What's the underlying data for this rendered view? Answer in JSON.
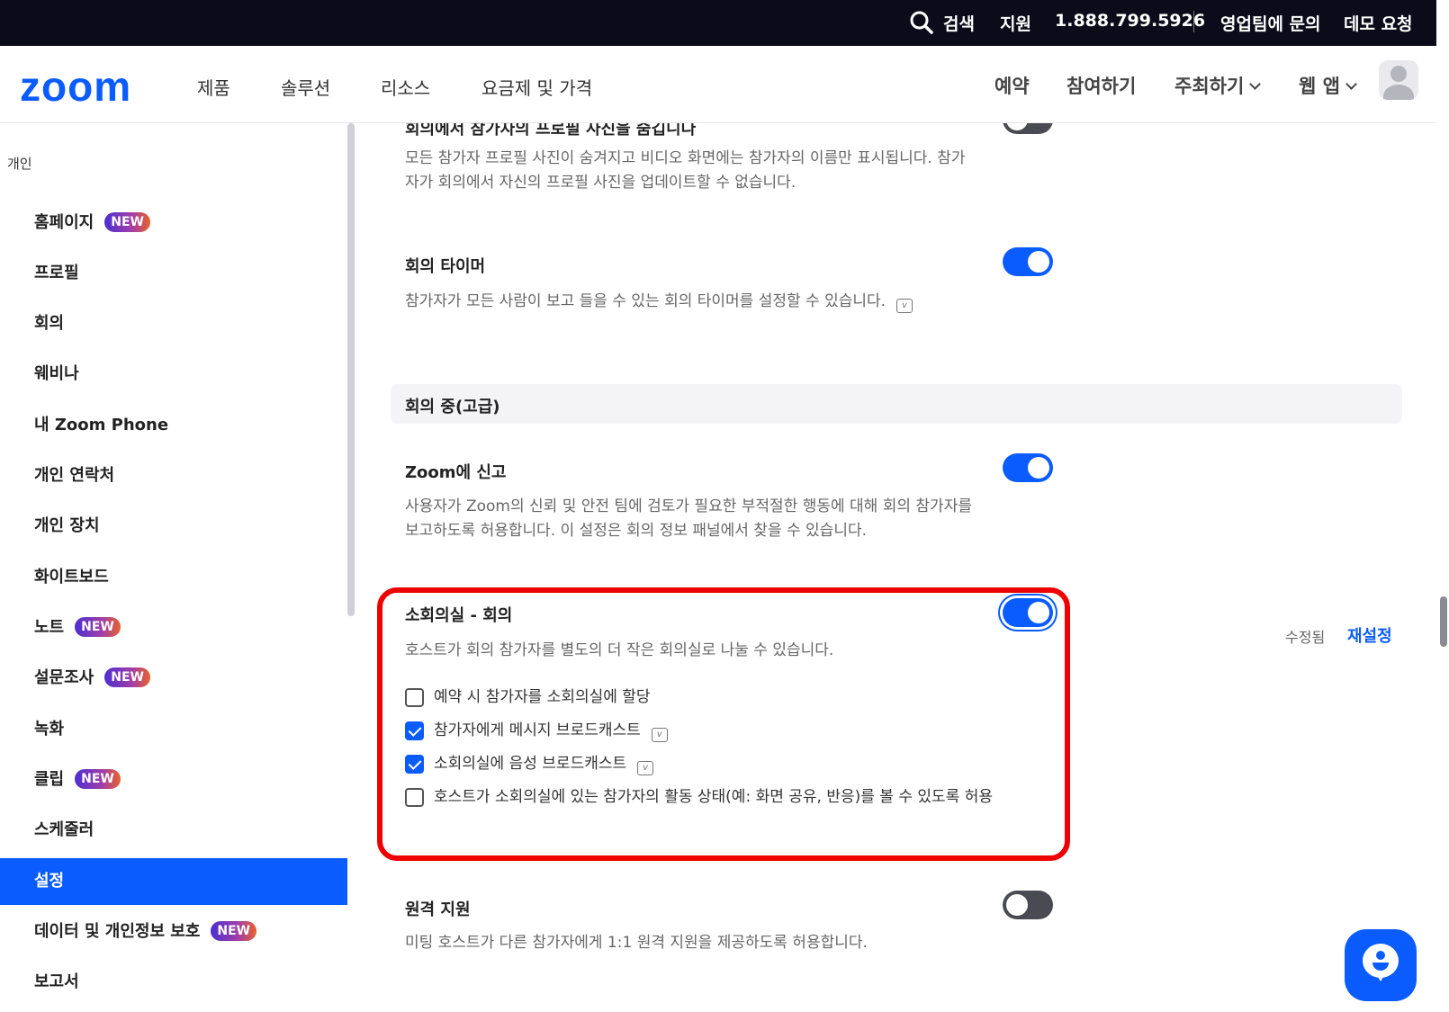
{
  "topbar": {
    "search": "검색",
    "support": "지원",
    "phone": "1.888.799.5926",
    "contact_sales": "영업팀에 문의",
    "demo": "데모 요청"
  },
  "header": {
    "logo": "zoom",
    "nav": [
      "제품",
      "솔루션",
      "리소스",
      "요금제 및 가격"
    ],
    "schedule": "예약",
    "join": "참여하기",
    "host": "주최하기",
    "web_app": "웹 앱"
  },
  "sidebar": {
    "heading": "개인",
    "badge_text": "NEW",
    "items": [
      {
        "label": "홈페이지",
        "new": true
      },
      {
        "label": "프로필",
        "new": false
      },
      {
        "label": "회의",
        "new": false
      },
      {
        "label": "웨비나",
        "new": false
      },
      {
        "label": "내 Zoom Phone",
        "new": false
      },
      {
        "label": "개인 연락처",
        "new": false
      },
      {
        "label": "개인 장치",
        "new": false
      },
      {
        "label": "화이트보드",
        "new": false
      },
      {
        "label": "노트",
        "new": true
      },
      {
        "label": "설문조사",
        "new": true
      },
      {
        "label": "녹화",
        "new": false
      },
      {
        "label": "클립",
        "new": true
      },
      {
        "label": "스케줄러",
        "new": false
      },
      {
        "label": "설정",
        "new": false,
        "active": true
      },
      {
        "label": "데이터 및 개인정보 보호",
        "new": true
      },
      {
        "label": "보고서",
        "new": false
      }
    ]
  },
  "settings": {
    "hide_photos": {
      "title": "회의에서 참가자의 프로필 사진을 숨깁니다",
      "desc": "모든 참가자 프로필 사진이 숨겨지고 비디오 화면에는 참가자의 이름만 표시됩니다. 참가자가 회의에서 자신의 프로필 사진을 업데이트할 수 없습니다.",
      "enabled": false
    },
    "meeting_timer": {
      "title": "회의 타이머",
      "desc": "참가자가 모든 사람이 보고 들을 수 있는 회의 타이머를 설정할 수 있습니다.",
      "enabled": true
    },
    "section_advanced": "회의 중(고급)",
    "report_to_zoom": {
      "title": "Zoom에 신고",
      "desc": "사용자가 Zoom의 신뢰 및 안전 팀에 검토가 필요한 부적절한 행동에 대해 회의 참가자를 보고하도록 허용합니다. 이 설정은 회의 정보 패널에서 찾을 수 있습니다.",
      "enabled": true
    },
    "breakout_rooms": {
      "title": "소회의실 - 회의",
      "desc": "호스트가 회의 참가자를 별도의 더 작은 회의실로 나눌 수 있습니다.",
      "enabled": true,
      "modified": "수정됨",
      "reset": "재설정",
      "options": [
        {
          "label": "예약 시 참가자를 소회의실에 할당",
          "checked": false
        },
        {
          "label": "참가자에게 메시지 브로드캐스트",
          "checked": true
        },
        {
          "label": "소회의실에 음성 브로드캐스트",
          "checked": true
        },
        {
          "label": "호스트가 소회의실에 있는 참가자의 활동 상태(예: 화면 공유, 반응)를 볼 수 있도록 허용",
          "checked": false
        }
      ]
    },
    "remote_support": {
      "title": "원격 지원",
      "desc": "미팅 호스트가 다른 참가자에게 1:1 원격 지원을 제공하도록 허용합니다.",
      "enabled": false
    }
  },
  "icons": {
    "search": "search-icon",
    "chevron": "chevron-down-icon",
    "avatar": "user-avatar-icon",
    "version": "version-info-icon",
    "chat": "chat-support-icon"
  },
  "colors": {
    "accent": "#0b5cff",
    "topbar": "#0b0b1a",
    "highlight": "#ee0000"
  }
}
